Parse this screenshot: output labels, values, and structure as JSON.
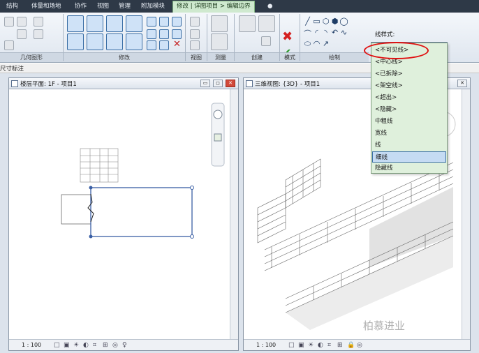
{
  "tabs": [
    "结构",
    "体量和场地",
    "协作",
    "视图",
    "管理",
    "附加模块",
    "修改 | 详图项目 > 编辑边界"
  ],
  "tab_extra_icon": "●",
  "panels": {
    "geometry": "几何图形",
    "modify": "修改",
    "view": "视图",
    "measure": "测量",
    "create": "创建",
    "mode": "模式",
    "draw": "绘制"
  },
  "line_style": {
    "label": "线样式:",
    "current": "细线",
    "options": [
      "<不可见线>",
      "<中心线>",
      "<已拆除>",
      "<架空线>",
      "<超出>",
      "<隐藏>",
      "中粗线",
      "宽线",
      "线",
      "细线",
      "隐藏线"
    ],
    "selected_index": 9
  },
  "edit_bar": {
    "text": "尺寸标注"
  },
  "views": {
    "plan": {
      "title": "楼层平面: 1F - 项目1",
      "scale": "1 : 100"
    },
    "threed": {
      "title": "三维视图: {3D} - 项目1",
      "scale": "1 : 100"
    }
  },
  "watermark": "柏慕进业",
  "colors": {
    "accent": "#3a6ea5",
    "active_tab": "#cfe9cf",
    "highlight_ring": "#e01010"
  }
}
